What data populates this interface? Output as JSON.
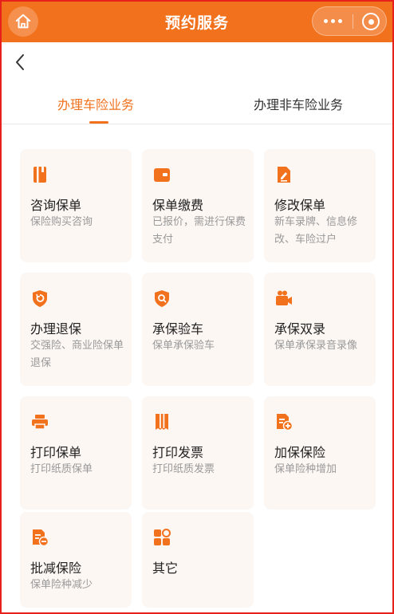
{
  "header": {
    "title": "预约服务"
  },
  "tabs": [
    {
      "label": "办理车险业务"
    },
    {
      "label": "办理非车险业务"
    }
  ],
  "colors": {
    "accent": "#f2711d",
    "card_bg": "#fdf7f3"
  },
  "services": [
    {
      "title": "咨询保单",
      "desc": "保险购买咨询",
      "icon": "book-icon"
    },
    {
      "title": "保单缴费",
      "desc": "已报价，需进行保费支付",
      "icon": "wallet-icon"
    },
    {
      "title": "修改保单",
      "desc": "新车录牌、信息修改、车险过户",
      "icon": "edit-document-icon"
    },
    {
      "title": "办理退保",
      "desc": "交强险、商业险保单退保",
      "icon": "refund-shield-icon"
    },
    {
      "title": "承保验车",
      "desc": "保单承保验车",
      "icon": "inspect-shield-icon"
    },
    {
      "title": "承保双录",
      "desc": "保单承保录音录像",
      "icon": "video-camera-icon"
    },
    {
      "title": "打印保单",
      "desc": "打印纸质保单",
      "icon": "printer-icon"
    },
    {
      "title": "打印发票",
      "desc": "打印纸质发票",
      "icon": "receipt-icon"
    },
    {
      "title": "加保保险",
      "desc": "保单险种增加",
      "icon": "document-add-icon"
    },
    {
      "title": "批减保险",
      "desc": "保单险种减少",
      "icon": "document-minus-icon"
    },
    {
      "title": "其它",
      "desc": "",
      "icon": "grid-icon"
    }
  ]
}
